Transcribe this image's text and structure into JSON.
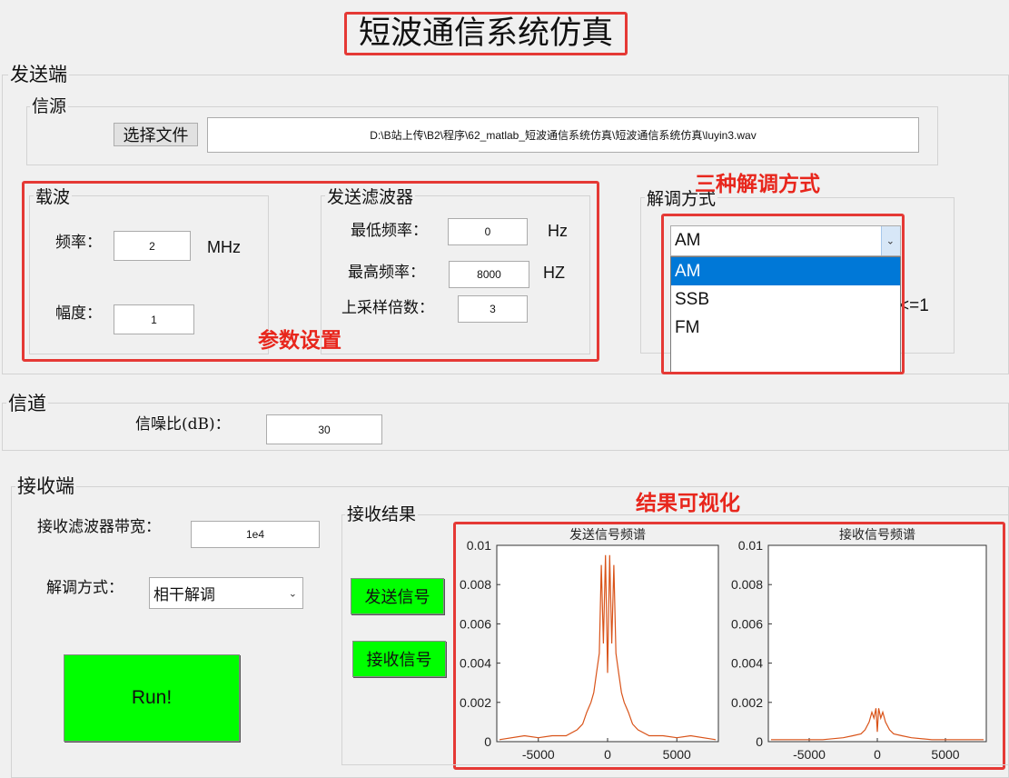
{
  "title": "短波通信系统仿真",
  "transmitter": {
    "title": "发送端",
    "source": {
      "title": "信源",
      "choose_file_label": "选择文件",
      "file_path": "D:\\B站上传\\B2\\程序\\62_matlab_短波通信系统仿真\\短波通信系统仿真\\luyin3.wav"
    },
    "carrier": {
      "title": "载波",
      "freq_label": "频率：",
      "freq_value": "2",
      "freq_unit": "MHz",
      "amp_label": "幅度：",
      "amp_value": "1"
    },
    "tx_filter": {
      "title": "发送滤波器",
      "min_label": "最低频率：",
      "min_value": "0",
      "min_unit": "Hz",
      "max_label": "最高频率：",
      "max_value": "8000",
      "max_unit": "HZ",
      "upsample_label": "上采样倍数：",
      "upsample_value": "3"
    },
    "modulation": {
      "title": "解调方式",
      "selected": "AM",
      "options": [
        "AM",
        "SSB",
        "FM"
      ],
      "highlighted": "AM",
      "partial_text": "<=1"
    }
  },
  "channel": {
    "title": "信道",
    "snr_label": "信噪比(dB)：",
    "snr_value": "30"
  },
  "receiver": {
    "title": "接收端",
    "bw_label": "接收滤波器带宽：",
    "bw_value": "1e4",
    "demod_label": "解调方式：",
    "demod_value": "相干解调",
    "run_label": "Run!",
    "results_title": "接收结果",
    "send_signal_btn": "发送信号",
    "recv_signal_btn": "接收信号"
  },
  "annotations": {
    "three_demod": "三种解调方式",
    "param_settings": "参数设置",
    "result_vis": "结果可视化"
  },
  "colors": {
    "run_button": "#00ff00",
    "annotation_red": "#e53935",
    "spectrum_line": "#d95319",
    "dropdown_highlight": "#0078d7"
  },
  "chart_data": [
    {
      "type": "line",
      "title": "发送信号频谱",
      "xlim": [
        -8000,
        8000
      ],
      "ylim": [
        0,
        0.01
      ],
      "xticks": [
        "-5000",
        "0",
        "5000"
      ],
      "yticks": [
        "0",
        "0.002",
        "0.004",
        "0.006",
        "0.008",
        "0.01"
      ],
      "series": [
        {
          "x": [
            -7800,
            -6000,
            -5000,
            -4000,
            -3000,
            -2200,
            -1800,
            -1500,
            -1200,
            -1000,
            -800,
            -600,
            -450,
            -300,
            -150,
            0,
            150,
            300,
            450,
            600,
            800,
            1000,
            1200,
            1500,
            1800,
            2200,
            3000,
            4000,
            5000,
            6000,
            7800
          ],
          "y": [
            0.0001,
            0.0003,
            0.0002,
            0.0003,
            0.0003,
            0.0006,
            0.0009,
            0.0015,
            0.002,
            0.0025,
            0.0035,
            0.0045,
            0.009,
            0.005,
            0.0095,
            0.0035,
            0.0095,
            0.005,
            0.009,
            0.0045,
            0.0035,
            0.0025,
            0.002,
            0.0015,
            0.0009,
            0.0006,
            0.0003,
            0.0003,
            0.0002,
            0.0003,
            0.0001
          ]
        }
      ]
    },
    {
      "type": "line",
      "title": "接收信号频谱",
      "xlim": [
        -8000,
        8000
      ],
      "ylim": [
        0,
        0.01
      ],
      "xticks": [
        "-5000",
        "0",
        "5000"
      ],
      "yticks": [
        "0",
        "0.002",
        "0.004",
        "0.006",
        "0.008",
        "0.01"
      ],
      "series": [
        {
          "x": [
            -7800,
            -6000,
            -4000,
            -2500,
            -1800,
            -1200,
            -900,
            -600,
            -400,
            -250,
            -100,
            0,
            100,
            250,
            400,
            600,
            900,
            1200,
            1800,
            2500,
            4000,
            6000,
            7800
          ],
          "y": [
            0.0001,
            0.0001,
            0.0001,
            0.0002,
            0.0003,
            0.0004,
            0.0006,
            0.001,
            0.0015,
            0.0012,
            0.0017,
            0.0005,
            0.0017,
            0.0012,
            0.0015,
            0.001,
            0.0006,
            0.0004,
            0.0003,
            0.0002,
            0.0001,
            0.0001,
            0.0001
          ]
        }
      ]
    }
  ]
}
